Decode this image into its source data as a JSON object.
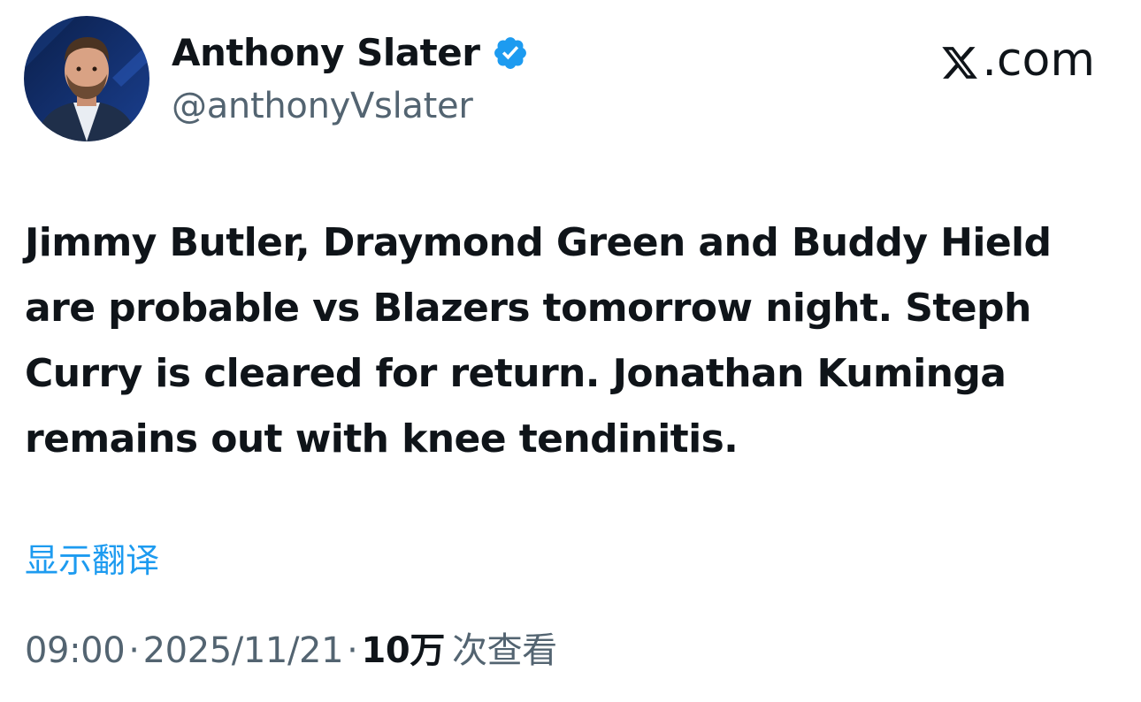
{
  "author": {
    "display_name": "Anthony Slater",
    "handle": "@anthonyVslater",
    "verified": true
  },
  "brand": {
    "label": ".com"
  },
  "tweet": {
    "text": "Jimmy Butler, Draymond Green and Buddy Hield are probable vs Blazers tomorrow night. Steph Curry is cleared for return. Jonathan Kuminga remains out with knee tendinitis.",
    "translate_label": "显示翻译"
  },
  "meta": {
    "time": "09:00",
    "separator": "·",
    "date": "2025/11/21",
    "views_count": "10万",
    "views_label": "次查看"
  },
  "colors": {
    "accent": "#1d9bf0",
    "secondary_text": "#536471",
    "primary_text": "#0f1419"
  },
  "icons": {
    "verified": "verified-badge-icon",
    "brand": "x-logo-icon"
  }
}
